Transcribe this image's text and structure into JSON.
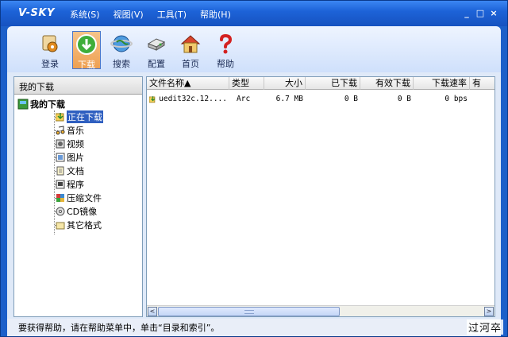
{
  "app": {
    "title": "V-SKY",
    "menu": [
      "系统(S)",
      "视图(V)",
      "工具(T)",
      "帮助(H)"
    ],
    "window_controls": [
      "_",
      "□",
      "×"
    ]
  },
  "toolbar": {
    "login": "登录",
    "download": "下载",
    "search": "搜索",
    "config": "配置",
    "home": "首页",
    "help": "帮助"
  },
  "left": {
    "header": "我的下载",
    "root": "我的下载",
    "items": [
      {
        "label": "正在下载",
        "icon": "downloading-icon",
        "selected": true
      },
      {
        "label": "音乐",
        "icon": "music-icon"
      },
      {
        "label": "视频",
        "icon": "video-icon"
      },
      {
        "label": "图片",
        "icon": "image-icon"
      },
      {
        "label": "文档",
        "icon": "document-icon"
      },
      {
        "label": "程序",
        "icon": "program-icon"
      },
      {
        "label": "压缩文件",
        "icon": "archive-icon"
      },
      {
        "label": "CD镜像",
        "icon": "cd-icon"
      },
      {
        "label": "其它格式",
        "icon": "folder-icon"
      }
    ]
  },
  "table": {
    "columns": [
      "文件名称▲",
      "类型",
      "大小",
      "已下载",
      "有效下载",
      "下载速率",
      "有"
    ],
    "rows": [
      {
        "name": "uedit32c.12....",
        "type": "Arc",
        "size": "6.7 MB",
        "downloaded": "0 B",
        "effective": "0 B",
        "rate": "0 bps"
      }
    ],
    "scroll_left": "<",
    "scroll_right": ">"
  },
  "status": {
    "text": "要获得帮助，请在帮助菜单中，单击“目录和索引”。",
    "watermark": "过河卒"
  },
  "colors": {
    "frame": "#1c5fc9",
    "panel": "#dfe9f8",
    "selection": "#2f5fc0"
  }
}
